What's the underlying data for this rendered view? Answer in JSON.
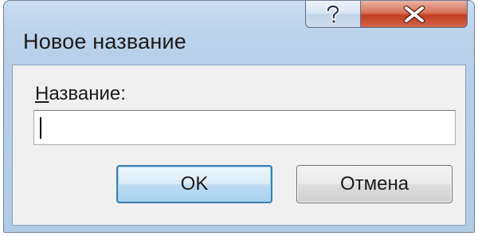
{
  "window": {
    "title": "Новое название"
  },
  "caption": {
    "help_icon": "question-mark-icon",
    "close_icon": "close-x-icon",
    "close_color": "#c23f22"
  },
  "form": {
    "label_accel": "Н",
    "label_rest": "азвание:",
    "name_value": "",
    "name_placeholder": ""
  },
  "buttons": {
    "ok_label": "OK",
    "cancel_label": "Отмена",
    "ok_accent": "#3c7fb1"
  }
}
